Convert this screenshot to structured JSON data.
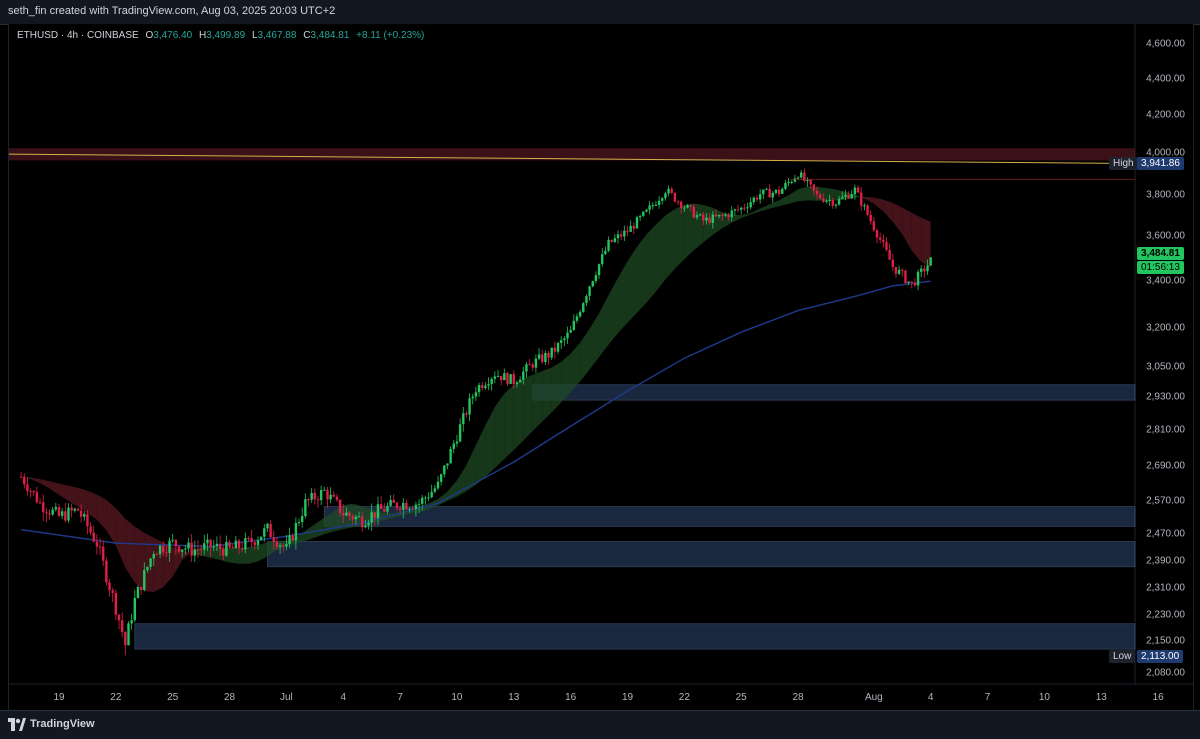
{
  "header": {
    "attribution": "seth_fin created with TradingView.com, Aug 03, 2025 20:03 UTC+2"
  },
  "legend": {
    "symbol": "ETHUSD · 4h · COINBASE",
    "open_label": "O",
    "open": "3,476.40",
    "high_label": "H",
    "high": "3,499.89",
    "low_label": "L",
    "low": "3,467.88",
    "close_label": "C",
    "close": "3,484.81",
    "change": "+8.11 (+0.23%)"
  },
  "price_tag": {
    "price": "3,484.81",
    "countdown": "01:56:13",
    "value": 3484.81
  },
  "high_tag": {
    "label": "High",
    "value_text": "3,941.86",
    "value": 3941.86
  },
  "low_tag": {
    "label": "Low",
    "value_text": "2,113.00",
    "value": 2113.0
  },
  "footer": {
    "brand": "TradingView"
  },
  "colors": {
    "up": "#26a69a",
    "down": "#ef5350",
    "up_bright": "#22c55e",
    "down_bright": "#e11d48",
    "zone": "#3b5a8c",
    "resistance": "#6b1d2a",
    "ema": "#1e3a8a",
    "trend": "#d4b04a"
  },
  "chart_data": {
    "type": "candlestick",
    "symbol": "ETHUSD",
    "interval": "4h",
    "exchange": "COINBASE",
    "y_ticks": [
      2080,
      2150,
      2230,
      2310,
      2390,
      2470,
      2570,
      2690,
      2810,
      2930,
      3050,
      3200,
      3400,
      3600,
      3800,
      4000,
      4200,
      4400,
      4600
    ],
    "y_tick_labels": [
      "2,080.00",
      "2,150.00",
      "2,230.00",
      "2,310.00",
      "2,390.00",
      "2,470.00",
      "2,570.00",
      "2,690.00",
      "2,810.00",
      "2,930.00",
      "3,050.00",
      "3,200.00",
      "3,400.00",
      "3,600.00",
      "3,800.00",
      "4,000.00",
      "4,200.00",
      "4,400.00",
      "4,600.00"
    ],
    "x_ticks": [
      {
        "label": "19",
        "day": 19
      },
      {
        "label": "22",
        "day": 22
      },
      {
        "label": "25",
        "day": 25
      },
      {
        "label": "28",
        "day": 28
      },
      {
        "label": "Jul",
        "day": 31
      },
      {
        "label": "4",
        "day": 34
      },
      {
        "label": "7",
        "day": 37
      },
      {
        "label": "10",
        "day": 40
      },
      {
        "label": "13",
        "day": 43
      },
      {
        "label": "16",
        "day": 46
      },
      {
        "label": "19",
        "day": 49
      },
      {
        "label": "22",
        "day": 52
      },
      {
        "label": "25",
        "day": 55
      },
      {
        "label": "28",
        "day": 58
      },
      {
        "label": "Aug",
        "day": 62
      },
      {
        "label": "4",
        "day": 65
      },
      {
        "label": "7",
        "day": 68
      },
      {
        "label": "10",
        "day": 71
      },
      {
        "label": "13",
        "day": 74
      },
      {
        "label": "16",
        "day": 77
      }
    ],
    "close_path": [
      [
        17,
        2650
      ],
      [
        18,
        2560
      ],
      [
        19,
        2520
      ],
      [
        20,
        2540
      ],
      [
        21,
        2440
      ],
      [
        22,
        2250
      ],
      [
        22.5,
        2140
      ],
      [
        23,
        2270
      ],
      [
        24,
        2420
      ],
      [
        25,
        2440
      ],
      [
        26,
        2420
      ],
      [
        27,
        2430
      ],
      [
        28,
        2420
      ],
      [
        29,
        2440
      ],
      [
        30,
        2480
      ],
      [
        31,
        2420
      ],
      [
        32,
        2560
      ],
      [
        33,
        2600
      ],
      [
        34,
        2530
      ],
      [
        35,
        2510
      ],
      [
        36,
        2540
      ],
      [
        37,
        2560
      ],
      [
        38,
        2560
      ],
      [
        39,
        2620
      ],
      [
        40,
        2790
      ],
      [
        41,
        2960
      ],
      [
        42,
        3020
      ],
      [
        43,
        2990
      ],
      [
        44,
        3060
      ],
      [
        45,
        3100
      ],
      [
        46,
        3180
      ],
      [
        47,
        3380
      ],
      [
        48,
        3560
      ],
      [
        49,
        3620
      ],
      [
        50,
        3710
      ],
      [
        51,
        3820
      ],
      [
        52,
        3740
      ],
      [
        53,
        3670
      ],
      [
        54,
        3690
      ],
      [
        55,
        3730
      ],
      [
        56,
        3800
      ],
      [
        57,
        3810
      ],
      [
        58,
        3900
      ],
      [
        59,
        3790
      ],
      [
        60,
        3760
      ],
      [
        61,
        3820
      ],
      [
        62,
        3640
      ],
      [
        63,
        3460
      ],
      [
        64,
        3380
      ],
      [
        65,
        3484.81
      ]
    ],
    "ema_path": [
      [
        17,
        2480
      ],
      [
        22,
        2440
      ],
      [
        27,
        2430
      ],
      [
        31,
        2460
      ],
      [
        35,
        2500
      ],
      [
        39,
        2560
      ],
      [
        43,
        2700
      ],
      [
        46,
        2820
      ],
      [
        49,
        2950
      ],
      [
        52,
        3080
      ],
      [
        55,
        3180
      ],
      [
        58,
        3270
      ],
      [
        61,
        3330
      ],
      [
        63,
        3375
      ],
      [
        65,
        3395
      ]
    ],
    "zones": [
      {
        "y1": 2130,
        "y2": 2200,
        "x_start": 23
      },
      {
        "y1": 2370,
        "y2": 2445,
        "x_start": 30
      },
      {
        "y1": 2490,
        "y2": 2550,
        "x_start": 33
      },
      {
        "y1": 2915,
        "y2": 2975,
        "x_start": 44
      }
    ],
    "resistance_band": {
      "y1": 3960,
      "y2": 4020
    },
    "high": 3941.86,
    "low": 2113.0,
    "last_price": 3484.81
  }
}
